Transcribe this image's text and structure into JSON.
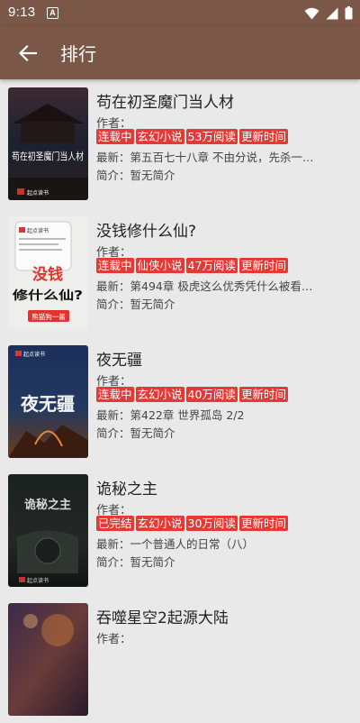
{
  "status": {
    "time": "9:13",
    "notif_letter": "A"
  },
  "header": {
    "title": "排行"
  },
  "labels": {
    "author": "作者：",
    "latest": "最新：",
    "intro": "简介："
  },
  "books": [
    {
      "title": "苟在初圣魔门当人材",
      "author": "",
      "tags": [
        "连载中",
        "玄幻小说",
        "53万阅读",
        "更新时间"
      ],
      "latest": "第五百七十八章 不由分说，先杀一…",
      "intro": "暂无简介",
      "cover_text": "苟在初圣魔门当人材",
      "publisher": "起点读书"
    },
    {
      "title": "没钱修什么仙?",
      "author": "",
      "tags": [
        "连载中",
        "仙侠小说",
        "47万阅读",
        "更新时间"
      ],
      "latest": "第494章 极虎这么优秀凭什么被看…",
      "intro": "暂无简介",
      "cover_top": "起点读书",
      "cover_text_1": "没钱",
      "cover_text_2": "修什么仙?",
      "cover_author": "熊猫狗一酱"
    },
    {
      "title": "夜无疆",
      "author": "",
      "tags": [
        "连载中",
        "玄幻小说",
        "40万阅读",
        "更新时间"
      ],
      "latest": "第422章 世界孤岛 2/2",
      "intro": "暂无简介",
      "cover_top": "起点读书",
      "cover_text": "夜无疆"
    },
    {
      "title": "诡秘之主",
      "author": "",
      "tags": [
        "已完结",
        "玄幻小说",
        "30万阅读",
        "更新时间"
      ],
      "latest": "一个普通人的日常（八）",
      "intro": "暂无简介",
      "cover_text": "诡秘之主",
      "publisher": "起点读书"
    },
    {
      "title": "吞噬星空2起源大陆",
      "author": "",
      "tags": [],
      "latest": "",
      "intro": ""
    }
  ]
}
